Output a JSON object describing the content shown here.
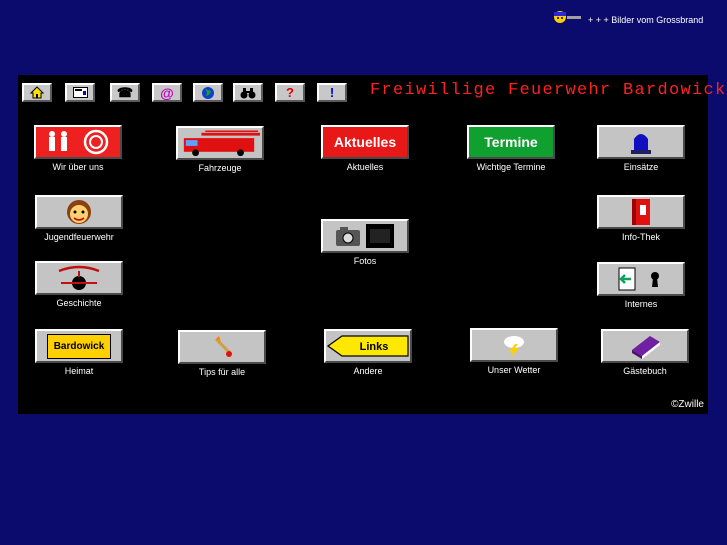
{
  "banner": {
    "text": "+ + + Bilder vom Grossbrand"
  },
  "header": {
    "title": "Freiwillige Feuerwehr Bardowick"
  },
  "toolbar": [
    {
      "name": "home-button",
      "icon": "home-icon",
      "glyph": "⌂"
    },
    {
      "name": "news-button",
      "icon": "window-icon",
      "glyph": "▤"
    },
    {
      "name": "phone-button",
      "icon": "phone-icon",
      "glyph": "☎"
    },
    {
      "name": "email-button",
      "icon": "at-icon",
      "glyph": "@"
    },
    {
      "name": "web-button",
      "icon": "globe-icon",
      "glyph": "●"
    },
    {
      "name": "search-button",
      "icon": "binoculars-icon",
      "glyph": "⌂"
    },
    {
      "name": "help-button",
      "icon": "question-icon",
      "glyph": "?"
    },
    {
      "name": "info-button",
      "icon": "exclamation-icon",
      "glyph": "!"
    }
  ],
  "tiles": {
    "wir": {
      "label": "Wir über uns"
    },
    "fahrzeuge": {
      "label": "Fahrzeuge"
    },
    "aktuelles": {
      "label": "Aktuelles",
      "badge": "Aktuelles"
    },
    "termine": {
      "label": "Wichtige Termine",
      "badge": "Termine"
    },
    "einsaetze": {
      "label": "Einsätze"
    },
    "jugend": {
      "label": "Jugendfeuerwehr"
    },
    "fotos": {
      "label": "Fotos"
    },
    "infothek": {
      "label": "Info-Thek"
    },
    "geschichte": {
      "label": "Geschichte"
    },
    "internes": {
      "label": "Internes"
    },
    "heimat": {
      "label": "Heimat",
      "badge": "Bardowick"
    },
    "tips": {
      "label": "Tips für alle"
    },
    "andere": {
      "label": "Andere",
      "badge": "Links"
    },
    "wetter": {
      "label": "Unser Wetter"
    },
    "gaestebuch": {
      "label": "Gästebuch"
    }
  },
  "footer": {
    "copyright": "©Zwille"
  },
  "colors": {
    "background": "#0b0b6e",
    "panel": "#000000",
    "title": "#ff2020"
  }
}
